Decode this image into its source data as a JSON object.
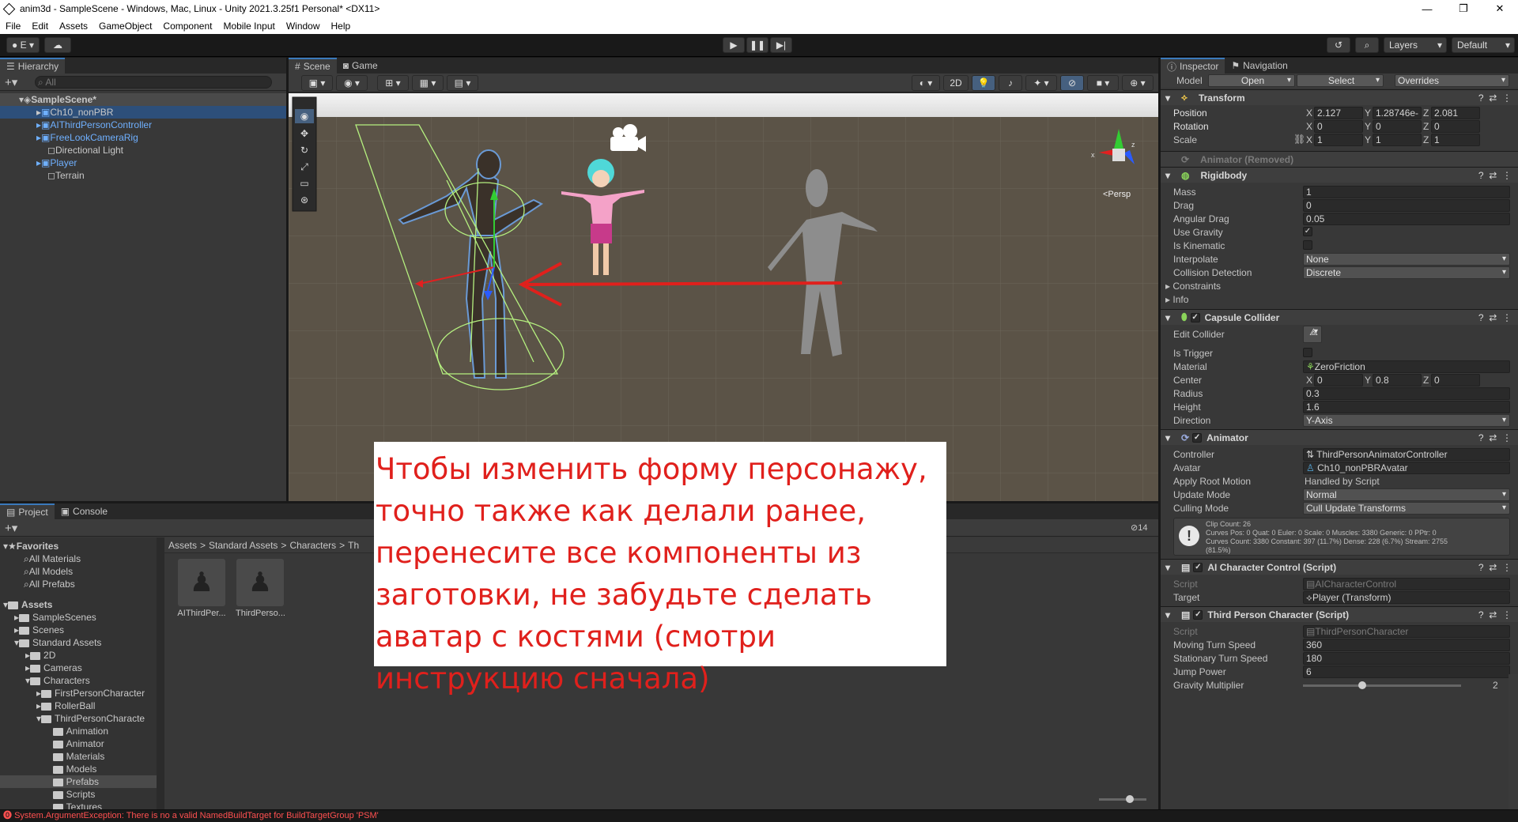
{
  "window": {
    "title": "anim3d - SampleScene - Windows, Mac, Linux - Unity 2021.3.25f1 Personal* <DX11>",
    "minimize": "—",
    "maximize": "❐",
    "close": "✕"
  },
  "menu": [
    "File",
    "Edit",
    "Assets",
    "GameObject",
    "Component",
    "Mobile Input",
    "Window",
    "Help"
  ],
  "toolbar": {
    "account_label": "E",
    "layers": "Layers",
    "layout": "Default"
  },
  "hierarchy": {
    "tab": "Hierarchy",
    "search_placeholder": "All",
    "scene": "SampleScene*",
    "items": [
      "Ch10_nonPBR",
      "AIThirdPersonController",
      "FreeLookCameraRig",
      "Directional Light",
      "Player",
      "Terrain"
    ]
  },
  "scene": {
    "tab_scene": "Scene",
    "tab_game": "Game",
    "persp": "<Persp",
    "btn_2d": "2D"
  },
  "overlay_text": "Чтобы изменить форму персонажу, точно также как делали ранее, перенесите все компоненты из заготовки, не забудьте сделать аватар с костями (смотри инструкцию сначала)",
  "project": {
    "tab_project": "Project",
    "tab_console": "Console",
    "visible_count": "14",
    "breadcrumb": [
      "Assets",
      "Standard Assets",
      "Characters",
      "Th"
    ],
    "favorites": {
      "title": "Favorites",
      "items": [
        "All Materials",
        "All Models",
        "All Prefabs"
      ]
    },
    "assets": {
      "title": "Assets",
      "items": [
        {
          "label": "SampleScenes",
          "depth": 1
        },
        {
          "label": "Scenes",
          "depth": 1
        },
        {
          "label": "Standard Assets",
          "depth": 1
        },
        {
          "label": "2D",
          "depth": 2
        },
        {
          "label": "Cameras",
          "depth": 2
        },
        {
          "label": "Characters",
          "depth": 2
        },
        {
          "label": "FirstPersonCharacter",
          "depth": 3
        },
        {
          "label": "RollerBall",
          "depth": 3
        },
        {
          "label": "ThirdPersonCharacte",
          "depth": 3
        },
        {
          "label": "Animation",
          "depth": 4
        },
        {
          "label": "Animator",
          "depth": 4
        },
        {
          "label": "Materials",
          "depth": 4
        },
        {
          "label": "Models",
          "depth": 4
        },
        {
          "label": "Prefabs",
          "depth": 4
        },
        {
          "label": "Scripts",
          "depth": 4
        },
        {
          "label": "Textures",
          "depth": 4
        }
      ]
    },
    "files": [
      "AIThirdPer...",
      "ThirdPerso..."
    ]
  },
  "inspector": {
    "tab_inspector": "Inspector",
    "tab_navigation": "Navigation",
    "model_label": "Model",
    "open": "Open",
    "select": "Select",
    "overrides": "Overrides",
    "transform": {
      "title": "Transform",
      "position": {
        "label": "Position",
        "x": "2.127",
        "y": "1.28746e-",
        "z": "2.081"
      },
      "rotation": {
        "label": "Rotation",
        "x": "0",
        "y": "0",
        "z": "0"
      },
      "scale": {
        "label": "Scale",
        "x": "1",
        "y": "1",
        "z": "1"
      }
    },
    "animator_removed": "Animator (Removed)",
    "rigidbody": {
      "title": "Rigidbody",
      "fields": [
        {
          "label": "Mass",
          "value": "1"
        },
        {
          "label": "Drag",
          "value": "0"
        },
        {
          "label": "Angular Drag",
          "value": "0.05"
        }
      ],
      "use_gravity": "Use Gravity",
      "use_gravity_checked": true,
      "is_kinematic": "Is Kinematic",
      "is_kinematic_checked": false,
      "interpolate": {
        "label": "Interpolate",
        "value": "None"
      },
      "collision": {
        "label": "Collision Detection",
        "value": "Discrete"
      },
      "constraints": "Constraints",
      "info": "Info"
    },
    "capsule": {
      "title": "Capsule Collider",
      "edit_collider": "Edit Collider",
      "is_trigger": "Is Trigger",
      "material": {
        "label": "Material",
        "value": "ZeroFriction"
      },
      "center": {
        "label": "Center",
        "x": "0",
        "y": "0.8",
        "z": "0"
      },
      "radius": {
        "label": "Radius",
        "value": "0.3"
      },
      "height": {
        "label": "Height",
        "value": "1.6"
      },
      "direction": {
        "label": "Direction",
        "value": "Y-Axis"
      }
    },
    "animator": {
      "title": "Animator",
      "controller": {
        "label": "Controller",
        "value": "ThirdPersonAnimatorController"
      },
      "avatar": {
        "label": "Avatar",
        "value": "Ch10_nonPBRAvatar"
      },
      "apply_root": {
        "label": "Apply Root Motion",
        "value": "Handled by Script"
      },
      "update_mode": {
        "label": "Update Mode",
        "value": "Normal"
      },
      "culling": {
        "label": "Culling Mode",
        "value": "Cull Update Transforms"
      },
      "info": [
        "Clip Count: 26",
        "Curves Pos: 0 Quat: 0 Euler: 0 Scale: 0 Muscles: 3380 Generic: 0 PPtr: 0",
        "Curves Count: 3380 Constant: 397 (11.7%) Dense: 228 (6.7%) Stream: 2755",
        "(81.5%)"
      ]
    },
    "ai_control": {
      "title": "AI Character Control (Script)",
      "script": {
        "label": "Script",
        "value": "AICharacterControl"
      },
      "target": {
        "label": "Target",
        "value": "Player (Transform)"
      }
    },
    "tpc": {
      "title": "Third Person Character (Script)",
      "script": {
        "label": "Script",
        "value": "ThirdPersonCharacter"
      },
      "fields": [
        {
          "label": "Moving Turn Speed",
          "value": "360"
        },
        {
          "label": "Stationary Turn Speed",
          "value": "180"
        },
        {
          "label": "Jump Power",
          "value": "6"
        }
      ],
      "gravity": "Gravity Multiplier",
      "gravity_value": "2"
    }
  },
  "status": {
    "error": "System.ArgumentException: There is no a valid NamedBuildTarget for BuildTargetGroup 'PSM'"
  },
  "colors": {
    "accent": "#3a79bb",
    "arrow": "#e0201c",
    "overlay_text": "#e0201c",
    "error": "#ff5050"
  }
}
